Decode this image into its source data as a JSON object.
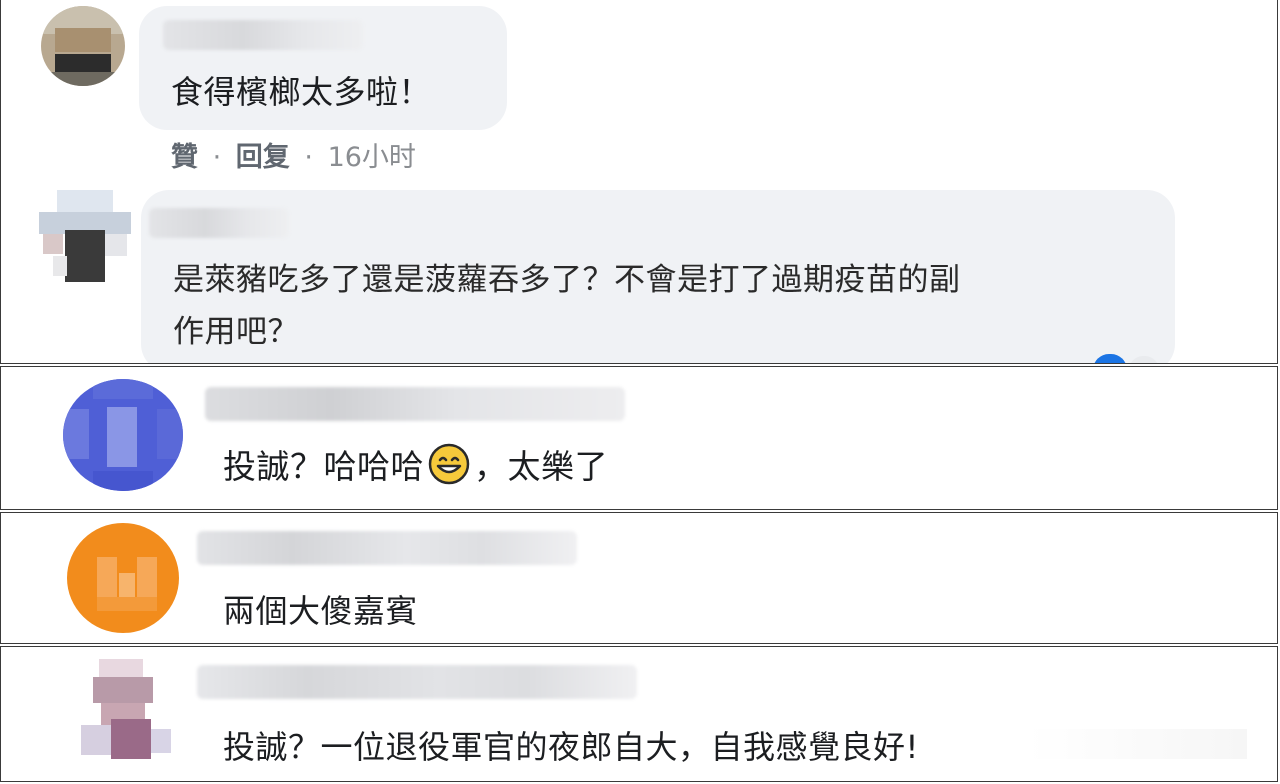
{
  "comments": [
    {
      "text": "食得檳榔太多啦！",
      "actions": {
        "like": "贊",
        "reply": "回复",
        "separator": "·",
        "time": "16小时"
      }
    },
    {
      "text_line1": "是萊豬吃多了還是菠蘿吞多了？不會是打了過期疫苗的副",
      "text_line2": "作用吧？"
    },
    {
      "text_before": "投誠？哈哈哈",
      "emoji": "grinning-face-emoji",
      "text_after": "，太樂了"
    },
    {
      "text": "兩個大傻嘉賓"
    },
    {
      "text": "投誠？一位退役軍官的夜郎自大，自我感覺良好!"
    }
  ],
  "colors": {
    "bubble": "#f0f2f5",
    "text": "#1c1e21",
    "meta": "#65676b",
    "divider": "#3a3a3a",
    "avatar_blue": "#4f5fd6",
    "avatar_orange": "#f28c1c"
  }
}
